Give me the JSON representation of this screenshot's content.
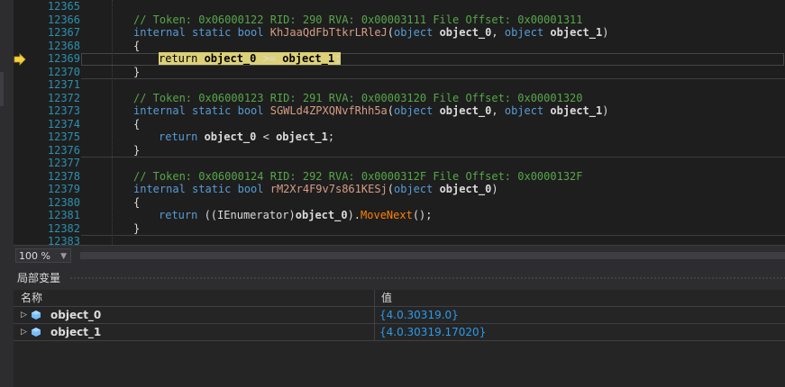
{
  "editor": {
    "lines": [
      {
        "num": "12365",
        "kind": "blank"
      },
      {
        "num": "12366",
        "kind": "comment",
        "text": "// Token: 0x06000122 RID: 290 RVA: 0x00003111 File Offset: 0x00001311"
      },
      {
        "num": "12367",
        "kind": "signature",
        "kw": "internal static bool ",
        "method": "KhJaaQdFbTtkrLRleJ",
        "open": "(",
        "t1": "object",
        "p1": " object_0",
        "comma": ", ",
        "t2": "object",
        "p2": " object_1",
        "close": ")"
      },
      {
        "num": "12368",
        "kind": "brace",
        "text": "{"
      },
      {
        "num": "12369",
        "kind": "current",
        "kw": "return",
        "expr1": " object_0 ",
        "op": ">=",
        "expr2": " object_1",
        "semi": ";"
      },
      {
        "num": "12370",
        "kind": "brace",
        "text": "}"
      },
      {
        "num": "12371",
        "kind": "blank"
      },
      {
        "num": "12372",
        "kind": "comment",
        "text": "// Token: 0x06000123 RID: 291 RVA: 0x00003120 File Offset: 0x00001320"
      },
      {
        "num": "12373",
        "kind": "signature",
        "kw": "internal static bool ",
        "method": "SGWLd4ZPXQNvfRhh5a",
        "open": "(",
        "t1": "object",
        "p1": " object_0",
        "comma": ", ",
        "t2": "object",
        "p2": " object_1",
        "close": ")"
      },
      {
        "num": "12374",
        "kind": "brace",
        "text": "{"
      },
      {
        "num": "12375",
        "kind": "stmt",
        "kw": "return",
        "expr1": " object_0 ",
        "op": "<",
        "expr2": " object_1",
        "semi": ";"
      },
      {
        "num": "12376",
        "kind": "brace",
        "text": "}"
      },
      {
        "num": "12377",
        "kind": "blank"
      },
      {
        "num": "12378",
        "kind": "comment",
        "text": "// Token: 0x06000124 RID: 292 RVA: 0x0000312F File Offset: 0x0000132F"
      },
      {
        "num": "12379",
        "kind": "signature1",
        "kw": "internal static bool ",
        "method": "rM2Xr4F9v7s861KESj",
        "open": "(",
        "t1": "object",
        "p1": " object_0",
        "close": ")"
      },
      {
        "num": "12380",
        "kind": "brace",
        "text": "{"
      },
      {
        "num": "12381",
        "kind": "enum",
        "kw": "return",
        "pre": " ((",
        "type": "IEnumerator",
        "mid": ")",
        "obj": "object_0",
        "dot": ").",
        "call": "MoveNext",
        "end": "();"
      },
      {
        "num": "12382",
        "kind": "brace",
        "text": "}"
      },
      {
        "num": "12383",
        "kind": "blank"
      }
    ]
  },
  "zoom": {
    "value": "100 %"
  },
  "locals": {
    "title": "局部变量",
    "col_name": "名称",
    "col_value": "值",
    "rows": [
      {
        "name": "object_0",
        "value": "{4.0.30319.0}"
      },
      {
        "name": "object_1",
        "value": "{4.0.30319.17020}"
      }
    ]
  },
  "colors": {
    "comment": "#57a64a",
    "keyword": "#569cd6",
    "method": "#d69d85",
    "current_highlight": "#dcd078",
    "value": "#2b9be8"
  },
  "icons": {
    "breakpoint": "current-statement-arrow-icon",
    "local": "object-icon"
  }
}
